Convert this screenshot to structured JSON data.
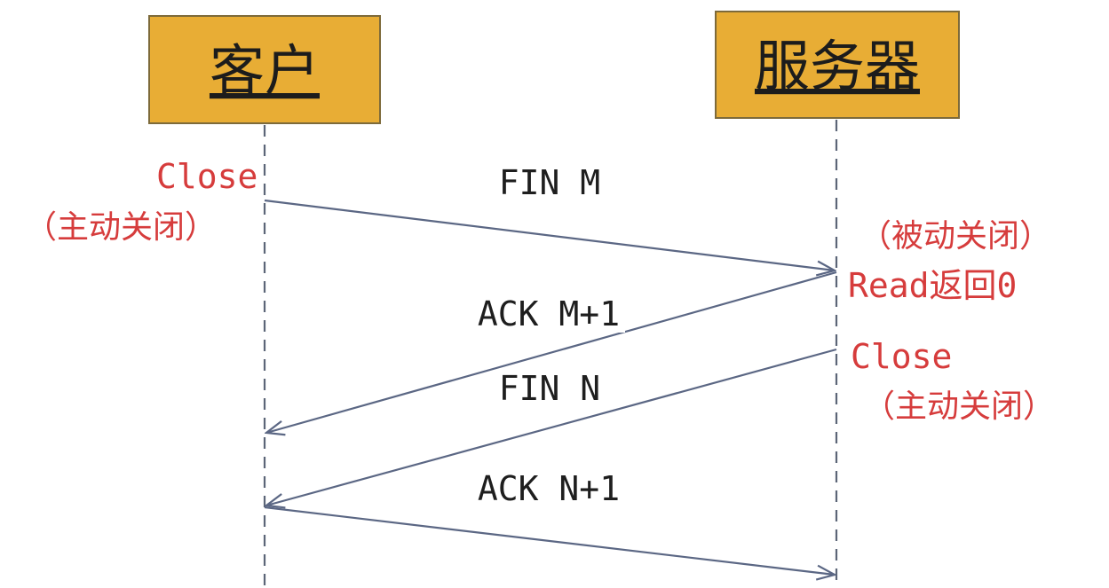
{
  "actors": {
    "client": {
      "label": "客户"
    },
    "server": {
      "label": "服务器"
    }
  },
  "messages": [
    {
      "label": "FIN M"
    },
    {
      "label": "ACK M+1"
    },
    {
      "label": "FIN N"
    },
    {
      "label": "ACK N+1"
    }
  ],
  "notes": {
    "client_close": "Close",
    "client_active": "（主动关闭）",
    "server_passive": "（被动关闭）",
    "server_read": "Read返回0",
    "server_close": "Close",
    "server_active": "（主动关闭）"
  },
  "colors": {
    "actor_fill": "#e8ad35",
    "note_text": "#d63c3c",
    "arrow": "#5b6784"
  }
}
